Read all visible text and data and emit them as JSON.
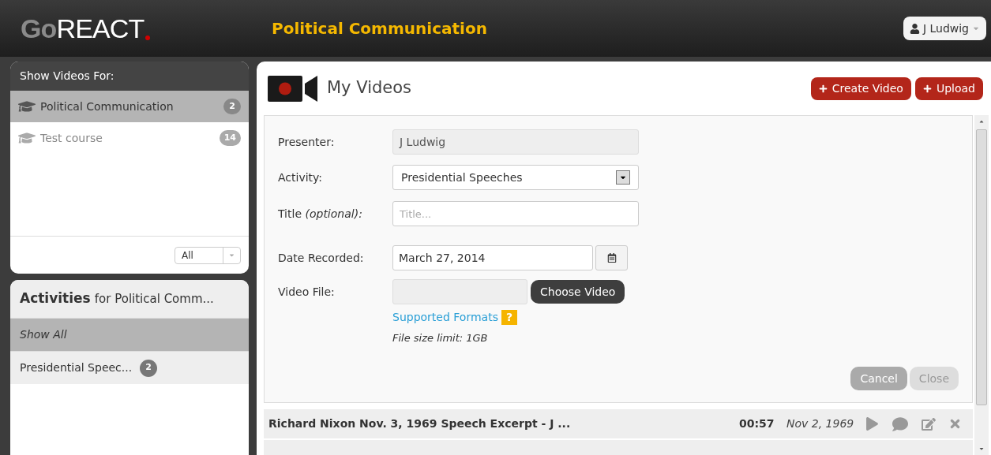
{
  "header": {
    "logo": {
      "prefix": "Go",
      "name": "REACT"
    },
    "course_title": "Political Communication",
    "user_menu": {
      "label": "J Ludwig"
    }
  },
  "courses": {
    "title": "Show Videos For:",
    "items": [
      {
        "name": "Political Communication",
        "count": "2",
        "selected": true
      },
      {
        "name": "Test course",
        "count": "14",
        "selected": false
      }
    ],
    "filter": {
      "value": "All"
    }
  },
  "activities": {
    "title": "Activities",
    "subtitle": "for Political Comm...",
    "items": [
      {
        "name": "Show All",
        "selected": true
      },
      {
        "name": "Presidential Speec...",
        "count": "2",
        "selected": false
      }
    ]
  },
  "main": {
    "title": "My Videos",
    "buttons": [
      {
        "label": "Create Video"
      },
      {
        "label": "Upload"
      }
    ],
    "form": {
      "presenter": {
        "label": "Presenter:",
        "value": "J Ludwig"
      },
      "activity": {
        "label": "Activity:",
        "value": "Presidential Speeches"
      },
      "title": {
        "label": "Title",
        "label_note": "(optional):",
        "placeholder": "Title..."
      },
      "date": {
        "label": "Date Recorded:",
        "value": "March 27, 2014"
      },
      "file": {
        "label": "Video File:",
        "button": "Choose Video"
      },
      "formats_link": "Supported Formats",
      "help_badge": "?",
      "size_limit": "File size limit: 1GB",
      "actions": [
        {
          "label": "Cancel",
          "disabled": false
        },
        {
          "label": "Close",
          "disabled": true
        }
      ]
    },
    "videos": [
      {
        "title": "Richard Nixon Nov. 3, 1969 Speech Excerpt - J ...",
        "duration": "00:57",
        "date": "Nov 2, 1969"
      }
    ]
  }
}
